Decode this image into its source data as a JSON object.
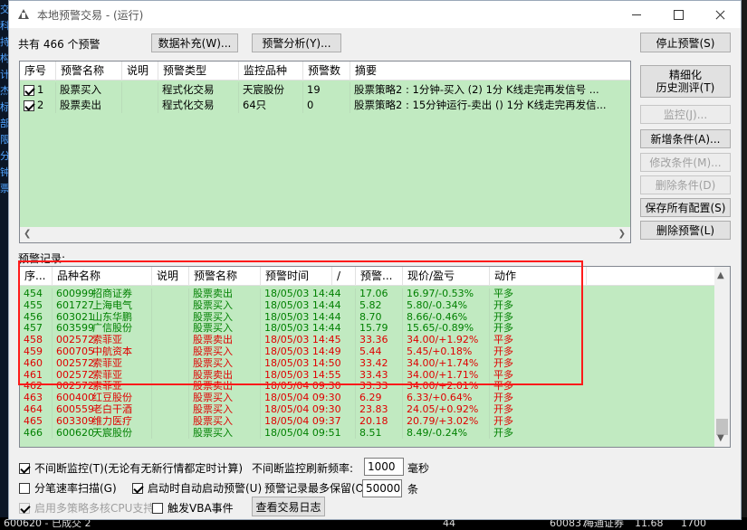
{
  "window": {
    "title": "本地预警交易 - (运行)"
  },
  "summary": {
    "count_text": "共有 466 个预警"
  },
  "top_buttons": {
    "data_fill": "数据补充(W)...",
    "alert_analysis": "预警分析(Y)...",
    "stop_alert": "停止预警(S)"
  },
  "right_buttons": {
    "refine_backtest_line1": "精细化",
    "refine_backtest_line2": "历史测评(T)",
    "monitor": "监控(J)...",
    "add_condition": "新增条件(A)...",
    "modify_condition": "修改条件(M)...",
    "delete_condition": "删除条件(D)",
    "save_all_config": "保存所有配置(S)",
    "delete_alert": "删除预警(L)"
  },
  "alert_table": {
    "columns": [
      "序号",
      "预警名称",
      "说明",
      "预警类型",
      "监控品种",
      "预警数",
      "摘要"
    ],
    "rows": [
      {
        "checked": true,
        "id": "1",
        "name": "股票买入",
        "desc": "",
        "type": "程式化交易",
        "target": "天宸股份",
        "count": "19",
        "summary": "股票策略2 : 1分钟-买入 (2) 1分 K线走完再发信号 ..."
      },
      {
        "checked": true,
        "id": "2",
        "name": "股票卖出",
        "desc": "",
        "type": "程式化交易",
        "target": "64只",
        "count": "0",
        "summary": "股票策略2 : 15分钟运行-卖出 () 1分 K线走完再发信..."
      }
    ]
  },
  "records_label": "预警记录:",
  "record_table": {
    "columns": [
      "序...",
      "品种名称",
      "说明",
      "预警名称",
      "预警时间",
      "/",
      "预警...",
      "现价/盈亏",
      "动作"
    ],
    "rows": [
      {
        "seq": "454",
        "code": "600999",
        "name": "招商证券",
        "desc": "",
        "alert": "股票卖出",
        "time": "18/05/03 14:44",
        "price": "17.06",
        "now": "16.97/-0.53%",
        "action": "平多",
        "color": "green"
      },
      {
        "seq": "455",
        "code": "601727",
        "name": "上海电气",
        "desc": "",
        "alert": "股票买入",
        "time": "18/05/03 14:44",
        "price": "5.82",
        "now": "5.80/-0.34%",
        "action": "开多",
        "color": "green"
      },
      {
        "seq": "456",
        "code": "603021",
        "name": "山东华鹏",
        "desc": "",
        "alert": "股票买入",
        "time": "18/05/03 14:44",
        "price": "8.70",
        "now": "8.66/-0.46%",
        "action": "开多",
        "color": "green"
      },
      {
        "seq": "457",
        "code": "603599",
        "name": "广信股份",
        "desc": "",
        "alert": "股票买入",
        "time": "18/05/03 14:44",
        "price": "15.79",
        "now": "15.65/-0.89%",
        "action": "开多",
        "color": "green"
      },
      {
        "seq": "458",
        "code": "002572",
        "name": "索菲亚",
        "desc": "",
        "alert": "股票卖出",
        "time": "18/05/03 14:45",
        "price": "33.36",
        "now": "34.00/+1.92%",
        "action": "平多",
        "color": "red"
      },
      {
        "seq": "459",
        "code": "600705",
        "name": "中航资本",
        "desc": "",
        "alert": "股票买入",
        "time": "18/05/03 14:49",
        "price": "5.44",
        "now": "5.45/+0.18%",
        "action": "开多",
        "color": "red"
      },
      {
        "seq": "460",
        "code": "002572",
        "name": "索菲亚",
        "desc": "",
        "alert": "股票买入",
        "time": "18/05/03 14:50",
        "price": "33.42",
        "now": "34.00/+1.74%",
        "action": "开多",
        "color": "red"
      },
      {
        "seq": "461",
        "code": "002572",
        "name": "索菲亚",
        "desc": "",
        "alert": "股票卖出",
        "time": "18/05/03 14:55",
        "price": "33.43",
        "now": "34.00/+1.71%",
        "action": "平多",
        "color": "red"
      },
      {
        "seq": "462",
        "code": "002572",
        "name": "索菲亚",
        "desc": "",
        "alert": "股票卖出",
        "time": "18/05/04 09:30",
        "price": "33.33",
        "now": "34.00/+2.01%",
        "action": "平多",
        "color": "red"
      },
      {
        "seq": "463",
        "code": "600400",
        "name": "红豆股份",
        "desc": "",
        "alert": "股票买入",
        "time": "18/05/04 09:30",
        "price": "6.29",
        "now": "6.33/+0.64%",
        "action": "开多",
        "color": "red"
      },
      {
        "seq": "464",
        "code": "600559",
        "name": "老白干酒",
        "desc": "",
        "alert": "股票买入",
        "time": "18/05/04 09:30",
        "price": "23.83",
        "now": "24.05/+0.92%",
        "action": "开多",
        "color": "red"
      },
      {
        "seq": "465",
        "code": "603309",
        "name": "维力医疗",
        "desc": "",
        "alert": "股票买入",
        "time": "18/05/04 09:37",
        "price": "20.18",
        "now": "20.79/+3.02%",
        "action": "开多",
        "color": "red"
      },
      {
        "seq": "466",
        "code": "600620",
        "name": "天宸股份",
        "desc": "",
        "alert": "股票买入",
        "time": "18/05/04 09:51",
        "price": "8.51",
        "now": "8.49/-0.24%",
        "action": "开多",
        "color": "green"
      }
    ]
  },
  "options": {
    "continuous_monitor": {
      "label": "不间断监控(T)(无论有无新行情都定时计算)",
      "checked": true
    },
    "refresh_label": "不间断监控刷新频率:",
    "refresh_value": "1000",
    "refresh_unit": "毫秒",
    "tick_scan": {
      "label": "分笔速率扫描(G)",
      "checked": false
    },
    "auto_start": {
      "label": "启动时自动启动预警(U)",
      "checked": true
    },
    "max_records_label": "预警记录最多保留(O):",
    "max_records_value": "50000",
    "max_records_unit": "条",
    "multicore": {
      "label": "启用多策略多核CPU支持",
      "checked": true,
      "disabled": true
    },
    "vba_event": {
      "label": "触发VBA事件",
      "checked": false
    },
    "view_log": "查看交易日志"
  },
  "background": {
    "left_chars": [
      "交",
      "科",
      "持",
      "构",
      "计",
      "杰",
      "标",
      "部",
      "限",
      "分",
      "钟",
      "票"
    ],
    "bottom_items": [
      "600620 - 已成交 2",
      "44",
      "600837",
      "海通证券",
      "11.68",
      "1700"
    ]
  },
  "colors": {
    "grid_bg": "#c1eac1",
    "highlight": "#ff1a1a",
    "gain": "#e00000",
    "loss": "#008000"
  }
}
